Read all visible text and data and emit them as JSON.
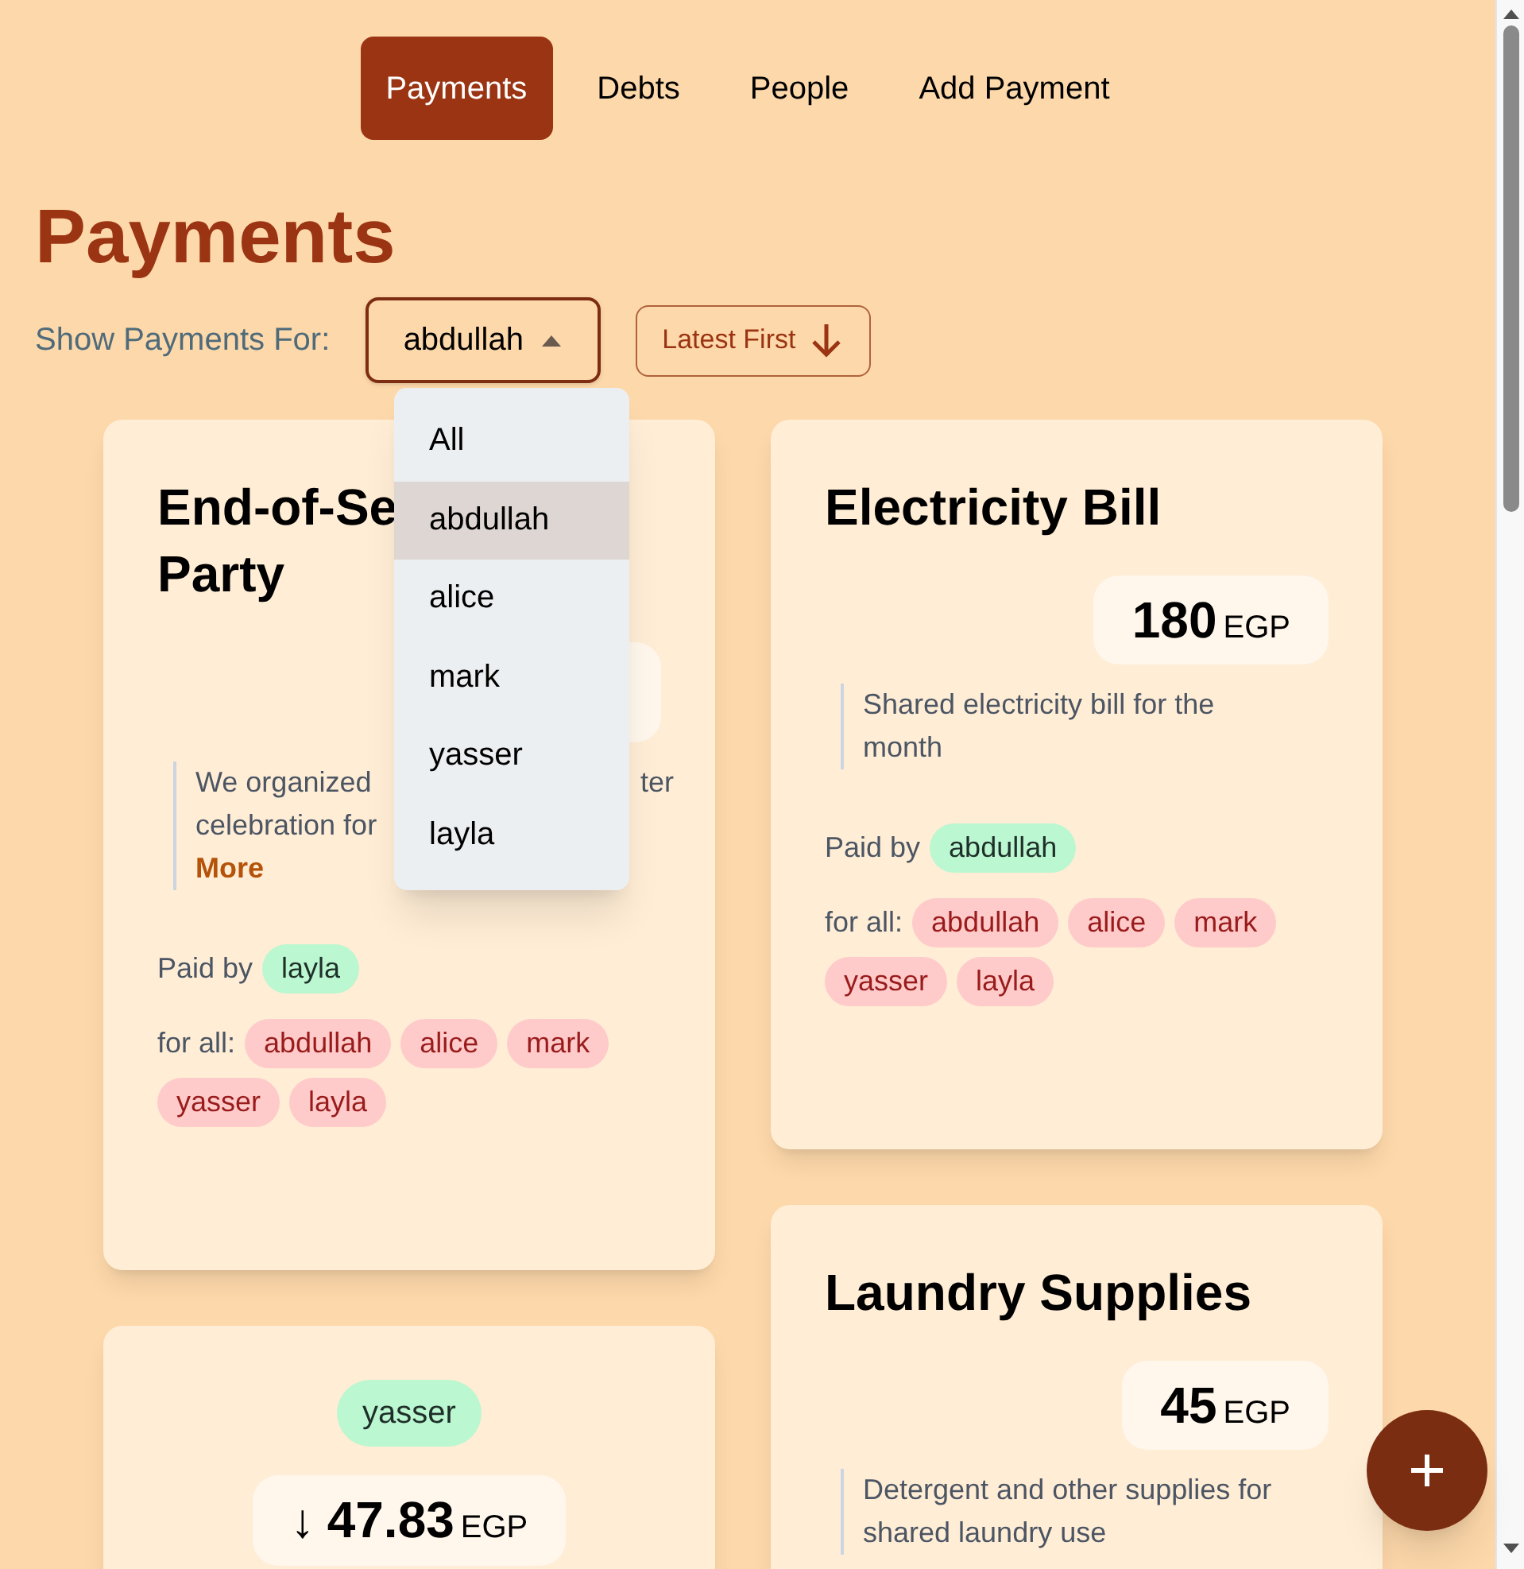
{
  "nav": {
    "tabs": [
      {
        "label": "Payments",
        "selected": true
      },
      {
        "label": "Debts",
        "selected": false
      },
      {
        "label": "People",
        "selected": false
      },
      {
        "label": "Add Payment",
        "selected": false
      }
    ]
  },
  "page_title": "Payments",
  "filter": {
    "label": "Show Payments For:",
    "select": {
      "value": "abdullah",
      "expanded": true
    },
    "sort_button": {
      "label": "Latest First"
    },
    "options": [
      {
        "label": "All",
        "selected": false
      },
      {
        "label": "abdullah",
        "selected": true
      },
      {
        "label": "alice",
        "selected": false
      },
      {
        "label": "mark",
        "selected": false
      },
      {
        "label": "yasser",
        "selected": false
      },
      {
        "label": "layla",
        "selected": false
      }
    ]
  },
  "columns": [
    [
      {
        "kind": "payment",
        "title_lines": [
          "End-of-Se",
          "Party"
        ],
        "amount": {
          "covered": true
        },
        "description": {
          "lines": [
            {
              "left": "We organized",
              "right": "ter"
            },
            {
              "left": "celebration for"
            }
          ],
          "more": "More"
        },
        "paid_by_label": "Paid by",
        "paid_by": "layla",
        "for_label": "for all:",
        "participants": [
          "abdullah",
          "alice",
          "mark",
          "yasser",
          "layla"
        ]
      },
      {
        "kind": "debt",
        "payer": "yasser",
        "amount": {
          "value": "47.83",
          "currency": "EGP",
          "arrow": "↓"
        }
      }
    ],
    [
      {
        "kind": "payment",
        "title_lines": [
          "Electricity Bill"
        ],
        "amount": {
          "value": "180",
          "currency": "EGP"
        },
        "description": {
          "text": "Shared electricity bill for the month"
        },
        "paid_by_label": "Paid by",
        "paid_by": "abdullah",
        "for_label": "for all:",
        "participants": [
          "abdullah",
          "alice",
          "mark",
          "yasser",
          "layla"
        ]
      },
      {
        "kind": "payment",
        "title_lines": [
          "Laundry Supplies"
        ],
        "amount": {
          "value": "45",
          "currency": "EGP"
        },
        "description": {
          "text": "Detergent and other supplies for shared laundry use"
        }
      }
    ]
  ]
}
